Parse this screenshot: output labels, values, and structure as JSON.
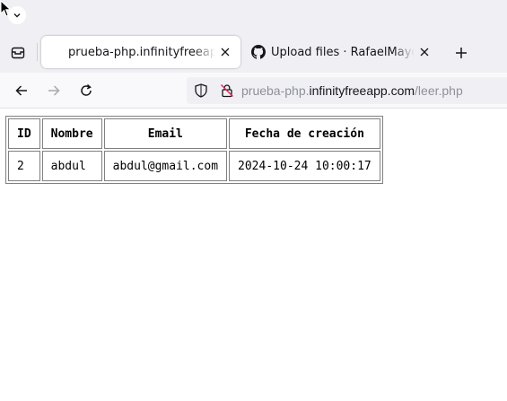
{
  "browser": {
    "tabs": [
      {
        "label": "prueba-php.infinityfreeapp.com",
        "active": true
      },
      {
        "label": "Upload files · RafaelMayor/DWES",
        "active": false,
        "icon": "github-icon"
      }
    ],
    "url": {
      "prefix": "prueba-php.",
      "host": "infinityfreeapp.com",
      "path": "/leer.php"
    }
  },
  "table": {
    "headers": [
      "ID",
      "Nombre",
      "Email",
      "Fecha de creación"
    ],
    "rows": [
      [
        "2",
        "abdul",
        "abdul@gmail.com",
        "2024-10-24 10:00:17"
      ]
    ]
  },
  "colors": {
    "chrome": "#f0f0f4",
    "navbar": "#f9f9fb",
    "text": "#15141a",
    "dim_text": "#8f8f9d"
  }
}
